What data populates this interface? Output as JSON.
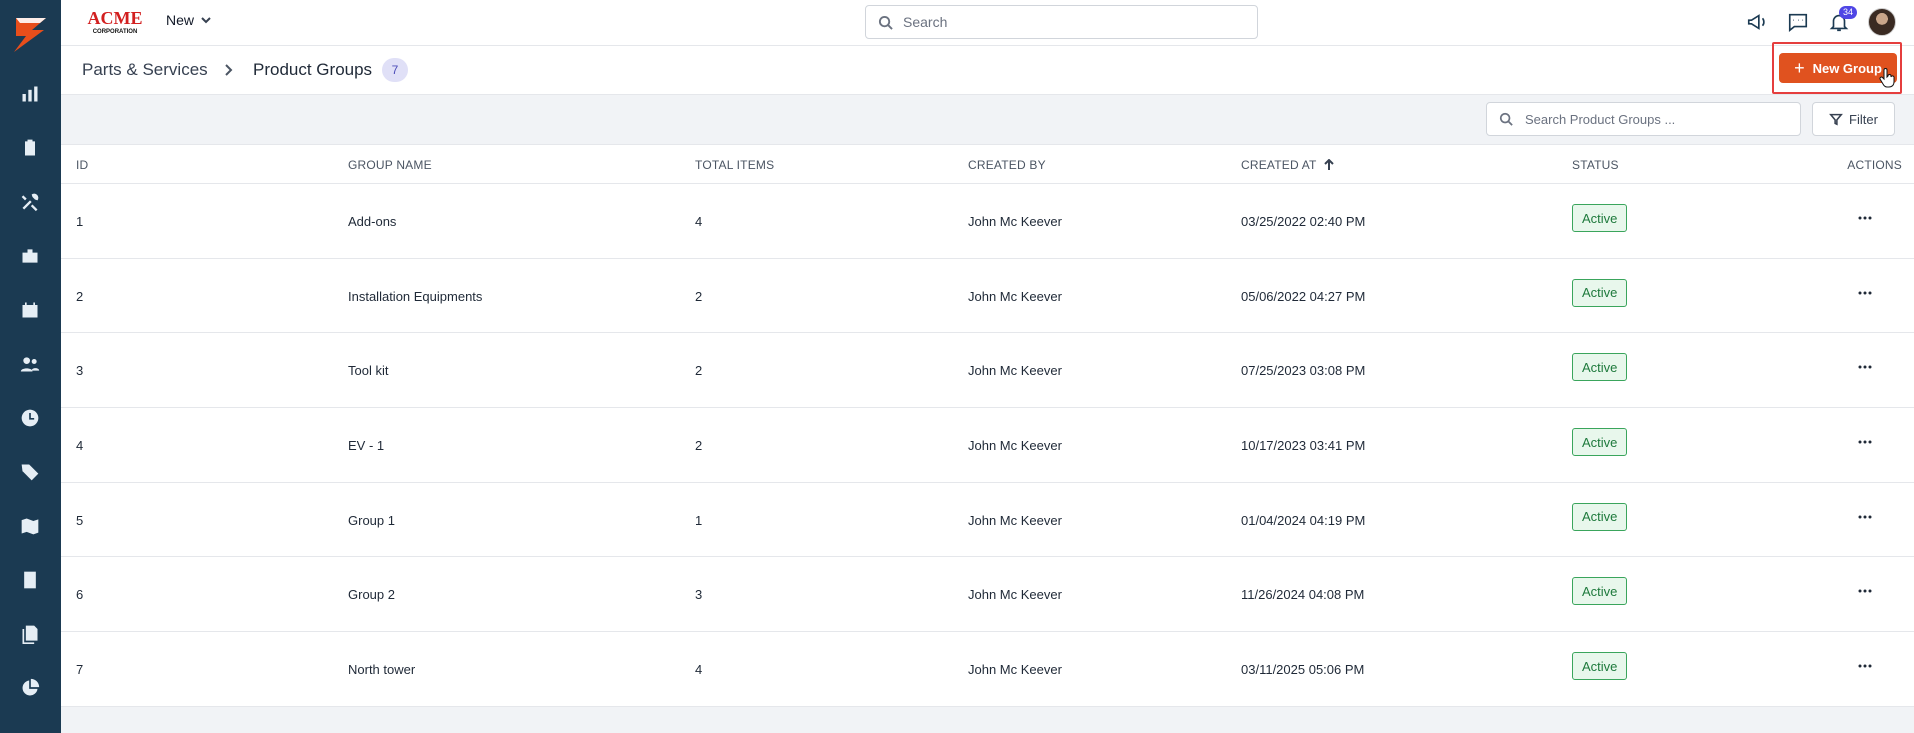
{
  "app": {
    "brand_top": "ACME",
    "brand_bottom": "CORPORATION",
    "new_menu_label": "New"
  },
  "search": {
    "placeholder": "Search"
  },
  "notifications": {
    "count": "34"
  },
  "breadcrumb": {
    "parent": "Parts & Services",
    "current": "Product Groups",
    "count": "7"
  },
  "actions": {
    "new_group_label": "New Group",
    "filter_label": "Filter",
    "table_search_placeholder": "Search Product Groups ..."
  },
  "table": {
    "headers": {
      "id": "ID",
      "name": "GROUP NAME",
      "items": "TOTAL ITEMS",
      "by": "CREATED BY",
      "at": "CREATED AT",
      "status": "STATUS",
      "actions": "ACTIONS"
    },
    "rows": [
      {
        "id": "1",
        "name": "Add-ons",
        "items": "4",
        "by": "John Mc Keever",
        "at": "03/25/2022 02:40 PM",
        "status": "Active"
      },
      {
        "id": "2",
        "name": "Installation Equipments",
        "items": "2",
        "by": "John Mc Keever",
        "at": "05/06/2022 04:27 PM",
        "status": "Active"
      },
      {
        "id": "3",
        "name": "Tool kit",
        "items": "2",
        "by": "John Mc Keever",
        "at": "07/25/2023 03:08 PM",
        "status": "Active"
      },
      {
        "id": "4",
        "name": "EV - 1",
        "items": "2",
        "by": "John Mc Keever",
        "at": "10/17/2023 03:41 PM",
        "status": "Active"
      },
      {
        "id": "5",
        "name": "Group 1",
        "items": "1",
        "by": "John Mc Keever",
        "at": "01/04/2024 04:19 PM",
        "status": "Active"
      },
      {
        "id": "6",
        "name": "Group 2",
        "items": "3",
        "by": "John Mc Keever",
        "at": "11/26/2024 04:08 PM",
        "status": "Active"
      },
      {
        "id": "7",
        "name": "North tower",
        "items": "4",
        "by": "John Mc Keever",
        "at": "03/11/2025 05:06 PM",
        "status": "Active"
      }
    ]
  },
  "colors": {
    "sidebar": "#1b3a52",
    "accent": "#e0521f",
    "status_green": "#3aa55c",
    "pill": "#e0e0f7"
  },
  "sidebar_icons": [
    "dashboard-chart-icon",
    "clipboard-icon",
    "tools-icon",
    "briefcase-icon",
    "calendar-icon",
    "users-icon",
    "clock-icon",
    "tag-icon",
    "map-icon",
    "calculator-icon",
    "documents-icon",
    "pie-chart-icon"
  ]
}
